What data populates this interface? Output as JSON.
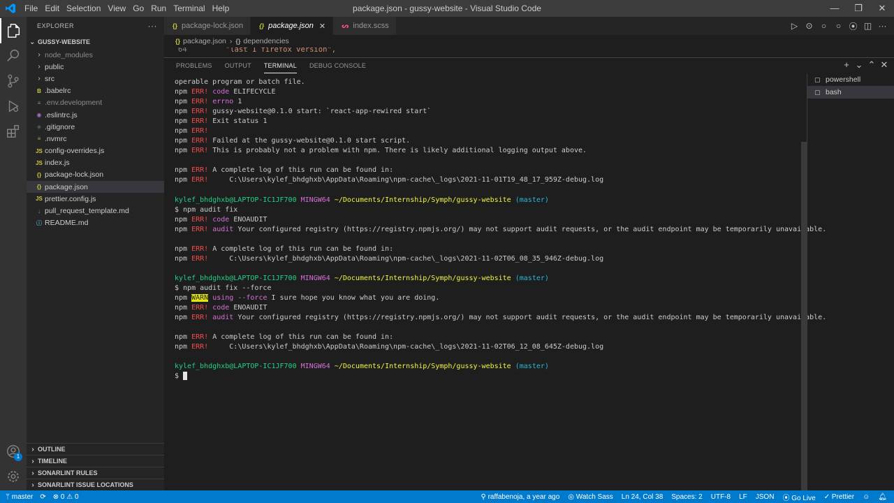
{
  "titlebar": {
    "menu": [
      "File",
      "Edit",
      "Selection",
      "View",
      "Go",
      "Run",
      "Terminal",
      "Help"
    ],
    "title": "package.json - gussy-website - Visual Studio Code"
  },
  "activity": {
    "items": [
      "explorer-icon",
      "search-icon",
      "source-control-icon",
      "run-debug-icon",
      "extensions-icon"
    ],
    "bottom": [
      "account-icon",
      "gear-icon"
    ],
    "account_badge": "1"
  },
  "sidebar": {
    "title": "EXPLORER",
    "more": "···",
    "root": "GUSSY-WEBSITE",
    "items": [
      {
        "label": "node_modules",
        "type": "folder",
        "icon": "",
        "color": "#c5c5c5",
        "dim": true
      },
      {
        "label": "public",
        "type": "folder",
        "icon": "",
        "color": "#c5c5c5",
        "dim": false
      },
      {
        "label": "src",
        "type": "folder",
        "icon": "",
        "color": "#c5c5c5",
        "dim": false
      },
      {
        "label": ".babelrc",
        "type": "file",
        "icon": "B",
        "color": "#cbcb41",
        "dim": false
      },
      {
        "label": ".env.development",
        "type": "file",
        "icon": "≡",
        "color": "#8c8c8c",
        "dim": true
      },
      {
        "label": ".eslintrc.js",
        "type": "file",
        "icon": "◉",
        "color": "#a074c4",
        "dim": false
      },
      {
        "label": ".gitignore",
        "type": "file",
        "icon": "◆",
        "color": "#41535b",
        "dim": false
      },
      {
        "label": ".nvmrc",
        "type": "file",
        "icon": "≡",
        "color": "#8dc149",
        "dim": false
      },
      {
        "label": "config-overrides.js",
        "type": "file",
        "icon": "JS",
        "color": "#cbcb41",
        "dim": false
      },
      {
        "label": "index.js",
        "type": "file",
        "icon": "JS",
        "color": "#cbcb41",
        "dim": false
      },
      {
        "label": "package-lock.json",
        "type": "file",
        "icon": "{}",
        "color": "#cbcb41",
        "dim": false
      },
      {
        "label": "package.json",
        "type": "file",
        "icon": "{}",
        "color": "#cbcb41",
        "dim": false,
        "selected": true
      },
      {
        "label": "prettier.config.js",
        "type": "file",
        "icon": "JS",
        "color": "#cbcb41",
        "dim": false
      },
      {
        "label": "pull_request_template.md",
        "type": "file",
        "icon": "↓",
        "color": "#519aba",
        "dim": false
      },
      {
        "label": "README.md",
        "type": "file",
        "icon": "ⓘ",
        "color": "#519aba",
        "dim": false
      }
    ],
    "sections": [
      "OUTLINE",
      "TIMELINE",
      "SONARLINT RULES",
      "SONARLINT ISSUE LOCATIONS"
    ]
  },
  "tabs": [
    {
      "label": "package-lock.json",
      "icon": "{}",
      "icon_color": "#cbcb41",
      "active": false
    },
    {
      "label": "package.json",
      "icon": "{}",
      "icon_color": "#cbcb41",
      "active": true,
      "close": "✕"
    },
    {
      "label": "index.scss",
      "icon": "ᔕ",
      "icon_color": "#f55385",
      "active": false
    }
  ],
  "breadcrumb": {
    "file": "package.json",
    "separator": "›",
    "node": "dependencies"
  },
  "editor": {
    "line_number": "64",
    "line_text": "\"last 1 firefox version\","
  },
  "panel": {
    "tabs": [
      "PROBLEMS",
      "OUTPUT",
      "TERMINAL",
      "DEBUG CONSOLE"
    ],
    "active_tab": "TERMINAL",
    "actions": [
      "+",
      "⌄",
      "⌃",
      "✕"
    ]
  },
  "terminal_lines": [
    [
      [
        "operable program or batch file.",
        ""
      ]
    ],
    [
      [
        "npm ",
        ""
      ],
      [
        "ERR!",
        "r"
      ],
      [
        " ",
        ""
      ],
      [
        "code",
        "m"
      ],
      [
        " ELIFECYCLE",
        ""
      ]
    ],
    [
      [
        "npm ",
        ""
      ],
      [
        "ERR!",
        "r"
      ],
      [
        " ",
        ""
      ],
      [
        "errno",
        "m"
      ],
      [
        " 1",
        ""
      ]
    ],
    [
      [
        "npm ",
        ""
      ],
      [
        "ERR!",
        "r"
      ],
      [
        " gussy-website@0.1.0 start: `react-app-rewired start`",
        ""
      ]
    ],
    [
      [
        "npm ",
        ""
      ],
      [
        "ERR!",
        "r"
      ],
      [
        " Exit status 1",
        ""
      ]
    ],
    [
      [
        "npm ",
        ""
      ],
      [
        "ERR!",
        "r"
      ]
    ],
    [
      [
        "npm ",
        ""
      ],
      [
        "ERR!",
        "r"
      ],
      [
        " Failed at the gussy-website@0.1.0 start script.",
        ""
      ]
    ],
    [
      [
        "npm ",
        ""
      ],
      [
        "ERR!",
        "r"
      ],
      [
        " This is probably not a problem with npm. There is likely additional logging output above.",
        ""
      ]
    ],
    [],
    [
      [
        "npm ",
        ""
      ],
      [
        "ERR!",
        "r"
      ],
      [
        " A complete log of this run can be found in:",
        ""
      ]
    ],
    [
      [
        "npm ",
        ""
      ],
      [
        "ERR!",
        "r"
      ],
      [
        "     C:\\Users\\kylef_bhdghxb\\AppData\\Roaming\\npm-cache\\_logs\\2021-11-01T19_48_17_959Z-debug.log",
        ""
      ]
    ],
    [],
    [
      [
        "kylef_bhdghxb@LAPTOP-IC1JF700",
        "g"
      ],
      [
        " ",
        ""
      ],
      [
        "MINGW64",
        "m"
      ],
      [
        " ",
        ""
      ],
      [
        "~/Documents/Internship/Symph/gussy-website",
        "y"
      ],
      [
        " ",
        ""
      ],
      [
        "(master)",
        "c"
      ]
    ],
    [
      [
        "$ npm audit fix",
        ""
      ]
    ],
    [
      [
        "npm ",
        ""
      ],
      [
        "ERR!",
        "r"
      ],
      [
        " ",
        ""
      ],
      [
        "code",
        "m"
      ],
      [
        " ENOAUDIT",
        ""
      ]
    ],
    [
      [
        "npm ",
        ""
      ],
      [
        "ERR!",
        "r"
      ],
      [
        " ",
        ""
      ],
      [
        "audit",
        "m"
      ],
      [
        " Your configured registry (https://registry.npmjs.org/) may not support audit requests, or the audit endpoint may be temporarily unavailable.",
        ""
      ]
    ],
    [],
    [
      [
        "npm ",
        ""
      ],
      [
        "ERR!",
        "r"
      ],
      [
        " A complete log of this run can be found in:",
        ""
      ]
    ],
    [
      [
        "npm ",
        ""
      ],
      [
        "ERR!",
        "r"
      ],
      [
        "     C:\\Users\\kylef_bhdghxb\\AppData\\Roaming\\npm-cache\\_logs\\2021-11-02T06_08_35_946Z-debug.log",
        ""
      ]
    ],
    [],
    [
      [
        "kylef_bhdghxb@LAPTOP-IC1JF700",
        "g"
      ],
      [
        " ",
        ""
      ],
      [
        "MINGW64",
        "m"
      ],
      [
        " ",
        ""
      ],
      [
        "~/Documents/Internship/Symph/gussy-website",
        "y"
      ],
      [
        " ",
        ""
      ],
      [
        "(master)",
        "c"
      ]
    ],
    [
      [
        "$ npm audit fix --force",
        ""
      ]
    ],
    [
      [
        "npm ",
        ""
      ],
      [
        "WARN",
        "w"
      ],
      [
        " ",
        ""
      ],
      [
        "using --force",
        "m"
      ],
      [
        " I sure hope you know what you are doing.",
        ""
      ]
    ],
    [
      [
        "npm ",
        ""
      ],
      [
        "ERR!",
        "r"
      ],
      [
        " ",
        ""
      ],
      [
        "code",
        "m"
      ],
      [
        " ENOAUDIT",
        ""
      ]
    ],
    [
      [
        "npm ",
        ""
      ],
      [
        "ERR!",
        "r"
      ],
      [
        " ",
        ""
      ],
      [
        "audit",
        "m"
      ],
      [
        " Your configured registry (https://registry.npmjs.org/) may not support audit requests, or the audit endpoint may be temporarily unavailable.",
        ""
      ]
    ],
    [],
    [
      [
        "npm ",
        ""
      ],
      [
        "ERR!",
        "r"
      ],
      [
        " A complete log of this run can be found in:",
        ""
      ]
    ],
    [
      [
        "npm ",
        ""
      ],
      [
        "ERR!",
        "r"
      ],
      [
        "     C:\\Users\\kylef_bhdghxb\\AppData\\Roaming\\npm-cache\\_logs\\2021-11-02T06_12_08_645Z-debug.log",
        ""
      ]
    ],
    [],
    [
      [
        "kylef_bhdghxb@LAPTOP-IC1JF700",
        "g"
      ],
      [
        " ",
        ""
      ],
      [
        "MINGW64",
        "m"
      ],
      [
        " ",
        ""
      ],
      [
        "~/Documents/Internship/Symph/gussy-website",
        "y"
      ],
      [
        " ",
        ""
      ],
      [
        "(master)",
        "c"
      ]
    ],
    [
      [
        "$ ",
        ""
      ],
      [
        "",
        "cursor"
      ]
    ]
  ],
  "terminals": [
    {
      "label": "powershell",
      "icon": "▢",
      "active": false
    },
    {
      "label": "bash",
      "icon": "▢",
      "active": true
    }
  ],
  "statusbar": {
    "branch": "master",
    "sync": "⟳",
    "problems": "⊗ 0 ⚠ 0",
    "blame": "raffabenoja, a year ago",
    "watch_sass": "Watch Sass",
    "position": "Ln 24, Col 38",
    "spaces": "Spaces: 2",
    "encoding": "UTF-8",
    "eol": "LF",
    "language": "JSON",
    "go_live": "Go Live",
    "prettier": "✓ Prettier"
  }
}
